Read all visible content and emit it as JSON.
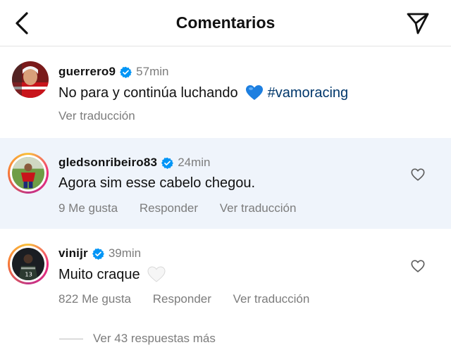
{
  "header": {
    "title": "Comentarios",
    "back_icon": "chevron-left-icon",
    "send_icon": "paper-plane-icon"
  },
  "comments": [
    {
      "username": "guerrero9",
      "time": "57min",
      "text": "No para y continúa luchando",
      "emoji": "blue-heart",
      "hashtag": "#vamoracing",
      "translate": "Ver traducción"
    },
    {
      "username": "gledsonribeiro83",
      "time": "24min",
      "text": "Agora sim esse cabelo chegou.",
      "likes": "9 Me gusta",
      "reply": "Responder",
      "translate": "Ver traducción"
    },
    {
      "username": "vinijr",
      "time": "39min",
      "text": "Muito craque",
      "emoji": "white-heart",
      "likes": "822 Me gusta",
      "reply": "Responder",
      "translate": "Ver traducción"
    }
  ],
  "more_replies": "Ver 43 respuestas más",
  "colors": {
    "verified": "#0095f6",
    "hashtag": "#00376b",
    "secondary_text": "#7c7c7c",
    "highlight_bg": "#eff4fb",
    "blue_heart": "#1d7fe0"
  }
}
